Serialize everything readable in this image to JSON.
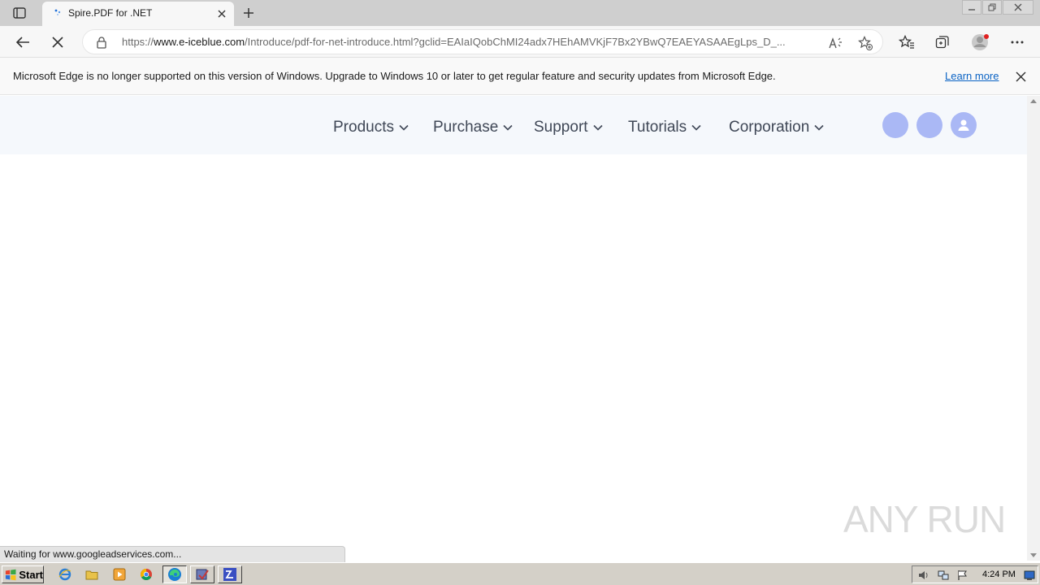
{
  "browser": {
    "tab": {
      "title": "Spire.PDF for .NET"
    },
    "address_bar": {
      "url_prefix": "https://",
      "url_host": "www.e-iceblue.com",
      "url_path": "/Introduce/pdf-for-net-introduce.html?gclid=EAIaIQobChMI24adx7HEhAMVKjF7Bx2YBwQ7EAEYASAAEgLps_D_..."
    },
    "infobar": {
      "message": "Microsoft Edge is no longer supported on this version of Windows. Upgrade to Windows 10 or later to get regular feature and security updates from Microsoft Edge.",
      "link": "Learn more"
    },
    "status_text": "Waiting for www.googleadservices.com..."
  },
  "site_nav": {
    "items": [
      {
        "label": "Products"
      },
      {
        "label": "Purchase"
      },
      {
        "label": "Support"
      },
      {
        "label": "Tutorials"
      },
      {
        "label": "Corporation"
      }
    ]
  },
  "watermark": "ANY RUN",
  "taskbar": {
    "start_label": "Start",
    "clock": "4:24 PM"
  },
  "colors": {
    "nav_bg": "#f5f8fc",
    "nav_text": "#3f4756",
    "circle": "#aab8f5",
    "link": "#0b63c4"
  }
}
